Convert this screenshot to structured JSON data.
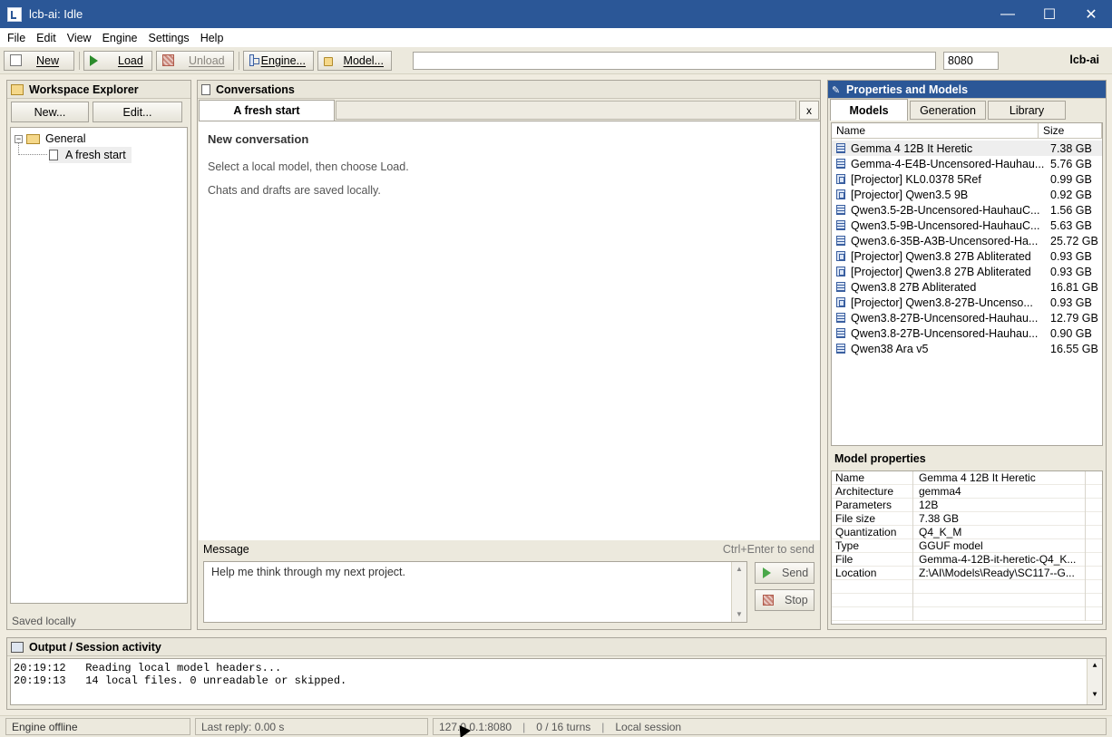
{
  "window": {
    "title": "lcb-ai: Idle"
  },
  "menu": [
    "File",
    "Edit",
    "View",
    "Engine",
    "Settings",
    "Help"
  ],
  "toolbar": {
    "new_label": "New",
    "load_label": "Load",
    "unload_label": "Unload",
    "engine_label": "Engine...",
    "model_label": "Model...",
    "path_value": "",
    "port_value": "8080",
    "brand": "lcb-ai"
  },
  "workspace": {
    "title": "Workspace Explorer",
    "new_button": "New...",
    "edit_button": "Edit...",
    "tree": {
      "folder": "General",
      "item": "A fresh start"
    },
    "status": "Saved locally"
  },
  "conversations": {
    "title": "Conversations",
    "active_tab": "A fresh start",
    "close_label": "x",
    "heading": "New conversation",
    "line1": "Select a local model, then choose Load.",
    "line2": "Chats and drafts are saved locally.",
    "message_label": "Message",
    "message_hint": "Ctrl+Enter to send",
    "message_value": "Help me think through my next project.",
    "send_label": "Send",
    "stop_label": "Stop"
  },
  "properties": {
    "title": "Properties and Models",
    "tabs": [
      "Models",
      "Generation",
      "Library"
    ],
    "columns": {
      "name": "Name",
      "size": "Size"
    },
    "models": [
      {
        "name": "Gemma 4 12B It Heretic",
        "size": "7.38 GB",
        "icon": "model-icon"
      },
      {
        "name": "Gemma-4-E4B-Uncensored-Hauhau...",
        "size": "5.76 GB",
        "icon": "model-icon"
      },
      {
        "name": "[Projector] KL0.0378 5Ref",
        "size": "0.99 GB",
        "icon": "projector-icon"
      },
      {
        "name": "[Projector] Qwen3.5 9B",
        "size": "0.92 GB",
        "icon": "projector-icon"
      },
      {
        "name": "Qwen3.5-2B-Uncensored-HauhauC...",
        "size": "1.56 GB",
        "icon": "model-icon"
      },
      {
        "name": "Qwen3.5-9B-Uncensored-HauhauC...",
        "size": "5.63 GB",
        "icon": "model-icon"
      },
      {
        "name": "Qwen3.6-35B-A3B-Uncensored-Ha...",
        "size": "25.72 GB",
        "icon": "model-icon"
      },
      {
        "name": "[Projector] Qwen3.8 27B Abliterated",
        "size": "0.93 GB",
        "icon": "projector-icon"
      },
      {
        "name": "[Projector] Qwen3.8 27B Abliterated",
        "size": "0.93 GB",
        "icon": "projector-icon"
      },
      {
        "name": "Qwen3.8 27B Abliterated",
        "size": "16.81 GB",
        "icon": "model-icon"
      },
      {
        "name": "[Projector] Qwen3.8-27B-Uncenso...",
        "size": "0.93 GB",
        "icon": "projector-icon"
      },
      {
        "name": "Qwen3.8-27B-Uncensored-Hauhau...",
        "size": "12.79 GB",
        "icon": "model-icon"
      },
      {
        "name": "Qwen3.8-27B-Uncensored-Hauhau...",
        "size": "0.90 GB",
        "icon": "model-icon"
      },
      {
        "name": "Qwen38 Ara v5",
        "size": "16.55 GB",
        "icon": "model-icon"
      }
    ],
    "model_properties_title": "Model properties",
    "model_properties": [
      {
        "key": "Name",
        "value": "Gemma 4 12B It Heretic"
      },
      {
        "key": "Architecture",
        "value": "gemma4"
      },
      {
        "key": "Parameters",
        "value": "12B"
      },
      {
        "key": "File size",
        "value": "7.38 GB"
      },
      {
        "key": "Quantization",
        "value": "Q4_K_M"
      },
      {
        "key": "Type",
        "value": "GGUF model"
      },
      {
        "key": "File",
        "value": "Gemma-4-12B-it-heretic-Q4_K..."
      },
      {
        "key": "Location",
        "value": "Z:\\AI\\Models\\Ready\\SC117--G..."
      }
    ]
  },
  "output": {
    "title": "Output / Session activity",
    "log": [
      "20:19:12   Reading local model headers...",
      "20:19:13   14 local files. 0 unreadable or skipped."
    ]
  },
  "status": {
    "engine": "Engine offline",
    "last_reply": "Last reply: 0.00 s",
    "address": "127.0.0.1:8080",
    "turns": "0 / 16 turns",
    "session": "Local session"
  },
  "colors": {
    "accent": "#2b5797",
    "surface": "#ece9dd"
  }
}
